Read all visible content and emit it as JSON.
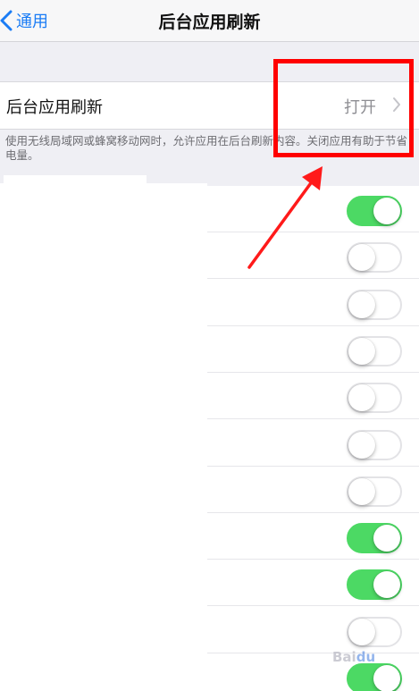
{
  "navbar": {
    "back_label": "通用",
    "title": "后台应用刷新"
  },
  "setting": {
    "label": "后台应用刷新",
    "value": "打开"
  },
  "footnote": "使用无线局域网或蜂窝移动网时，允许应用在后台刷新内容。关闭应用有助于节省电量。",
  "apps": [
    {
      "enabled": true
    },
    {
      "enabled": false
    },
    {
      "enabled": false
    },
    {
      "enabled": false
    },
    {
      "enabled": false
    },
    {
      "enabled": false
    },
    {
      "enabled": false
    },
    {
      "enabled": true
    },
    {
      "enabled": true
    },
    {
      "enabled": false
    },
    {
      "enabled": true
    }
  ],
  "colors": {
    "accent": "#1a7cf5",
    "toggle_on": "#4cd964",
    "annotation": "#ff0000"
  },
  "watermark": "Baidu"
}
